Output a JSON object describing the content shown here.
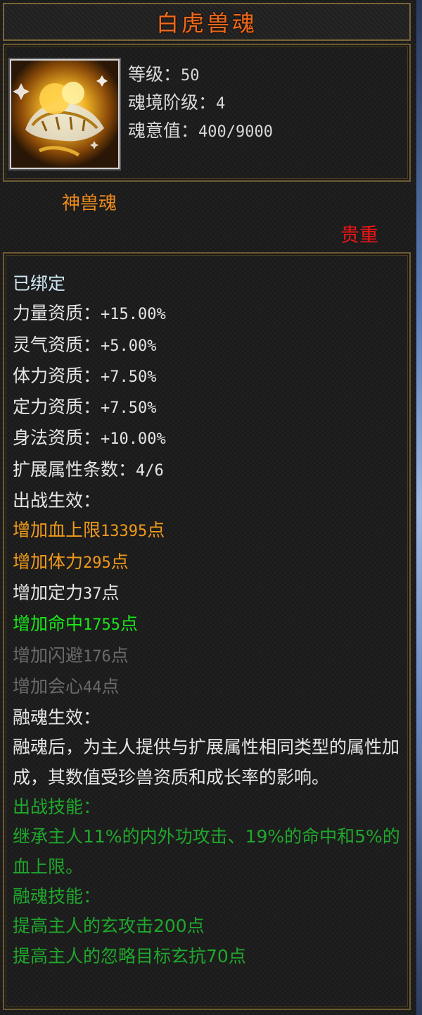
{
  "title": "白虎兽魂",
  "item": {
    "icon": "white-tiger-soul-icon",
    "stats": {
      "level_label": "等级：",
      "level_value": "50",
      "realm_label": "魂境阶级：",
      "realm_value": "4",
      "soul_label": "魂意值：",
      "soul_value": "400/9000"
    },
    "category": "神兽魂",
    "rarity": "贵重"
  },
  "body": {
    "bound": "已绑定",
    "aptitudes": [
      {
        "label": "力量资质：",
        "value": "+15.00%"
      },
      {
        "label": "灵气资质：",
        "value": "+5.00%"
      },
      {
        "label": "体力资质：",
        "value": "+7.50%"
      },
      {
        "label": "定力资质：",
        "value": "+7.50%"
      },
      {
        "label": "身法资质：",
        "value": "+10.00%"
      }
    ],
    "extend_count": {
      "label": "扩展属性条数：",
      "value": "4/6"
    },
    "battle_effect_label": "出战生效：",
    "bonuses": [
      {
        "prefix": "增加血上限",
        "value": "13395",
        "suffix": "点",
        "color": "#f09a1a"
      },
      {
        "prefix": "增加体力",
        "value": "295",
        "suffix": "点",
        "color": "#f09a1a"
      },
      {
        "prefix": "增加定力",
        "value": "37",
        "suffix": "点",
        "color": "#e6e6e6"
      },
      {
        "prefix": "增加命中",
        "value": "1755",
        "suffix": "点",
        "color": "#18e818"
      },
      {
        "prefix": "增加闪避",
        "value": "176",
        "suffix": "点",
        "color": "#6a6a6a"
      },
      {
        "prefix": "增加会心",
        "value": "44",
        "suffix": "点",
        "color": "#6a6a6a"
      }
    ],
    "fusion_effect_label": "融魂生效：",
    "fusion_description": "融魂后，为主人提供与扩展属性相同类型的属性加成，其数值受珍兽资质和成长率的影响。",
    "battle_skill_label": "出战技能：",
    "battle_skill_desc": "继承主人11%的内外功攻击、19%的命中和5%的血上限。",
    "fusion_skill_label": "融魂技能：",
    "fusion_skills": [
      "提高主人的玄攻击200点",
      "提高主人的忽略目标玄抗70点"
    ]
  }
}
